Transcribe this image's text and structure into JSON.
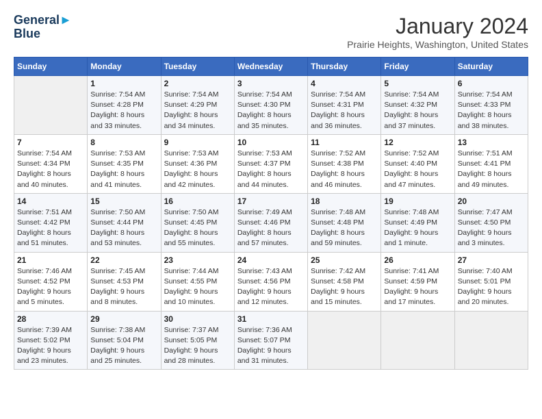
{
  "header": {
    "logo_line1": "General",
    "logo_line2": "Blue",
    "month": "January 2024",
    "location": "Prairie Heights, Washington, United States"
  },
  "weekdays": [
    "Sunday",
    "Monday",
    "Tuesday",
    "Wednesday",
    "Thursday",
    "Friday",
    "Saturday"
  ],
  "weeks": [
    [
      {
        "day": "",
        "info": ""
      },
      {
        "day": "1",
        "info": "Sunrise: 7:54 AM\nSunset: 4:28 PM\nDaylight: 8 hours\nand 33 minutes."
      },
      {
        "day": "2",
        "info": "Sunrise: 7:54 AM\nSunset: 4:29 PM\nDaylight: 8 hours\nand 34 minutes."
      },
      {
        "day": "3",
        "info": "Sunrise: 7:54 AM\nSunset: 4:30 PM\nDaylight: 8 hours\nand 35 minutes."
      },
      {
        "day": "4",
        "info": "Sunrise: 7:54 AM\nSunset: 4:31 PM\nDaylight: 8 hours\nand 36 minutes."
      },
      {
        "day": "5",
        "info": "Sunrise: 7:54 AM\nSunset: 4:32 PM\nDaylight: 8 hours\nand 37 minutes."
      },
      {
        "day": "6",
        "info": "Sunrise: 7:54 AM\nSunset: 4:33 PM\nDaylight: 8 hours\nand 38 minutes."
      }
    ],
    [
      {
        "day": "7",
        "info": "Sunrise: 7:54 AM\nSunset: 4:34 PM\nDaylight: 8 hours\nand 40 minutes."
      },
      {
        "day": "8",
        "info": "Sunrise: 7:53 AM\nSunset: 4:35 PM\nDaylight: 8 hours\nand 41 minutes."
      },
      {
        "day": "9",
        "info": "Sunrise: 7:53 AM\nSunset: 4:36 PM\nDaylight: 8 hours\nand 42 minutes."
      },
      {
        "day": "10",
        "info": "Sunrise: 7:53 AM\nSunset: 4:37 PM\nDaylight: 8 hours\nand 44 minutes."
      },
      {
        "day": "11",
        "info": "Sunrise: 7:52 AM\nSunset: 4:38 PM\nDaylight: 8 hours\nand 46 minutes."
      },
      {
        "day": "12",
        "info": "Sunrise: 7:52 AM\nSunset: 4:40 PM\nDaylight: 8 hours\nand 47 minutes."
      },
      {
        "day": "13",
        "info": "Sunrise: 7:51 AM\nSunset: 4:41 PM\nDaylight: 8 hours\nand 49 minutes."
      }
    ],
    [
      {
        "day": "14",
        "info": "Sunrise: 7:51 AM\nSunset: 4:42 PM\nDaylight: 8 hours\nand 51 minutes."
      },
      {
        "day": "15",
        "info": "Sunrise: 7:50 AM\nSunset: 4:44 PM\nDaylight: 8 hours\nand 53 minutes."
      },
      {
        "day": "16",
        "info": "Sunrise: 7:50 AM\nSunset: 4:45 PM\nDaylight: 8 hours\nand 55 minutes."
      },
      {
        "day": "17",
        "info": "Sunrise: 7:49 AM\nSunset: 4:46 PM\nDaylight: 8 hours\nand 57 minutes."
      },
      {
        "day": "18",
        "info": "Sunrise: 7:48 AM\nSunset: 4:48 PM\nDaylight: 8 hours\nand 59 minutes."
      },
      {
        "day": "19",
        "info": "Sunrise: 7:48 AM\nSunset: 4:49 PM\nDaylight: 9 hours\nand 1 minute."
      },
      {
        "day": "20",
        "info": "Sunrise: 7:47 AM\nSunset: 4:50 PM\nDaylight: 9 hours\nand 3 minutes."
      }
    ],
    [
      {
        "day": "21",
        "info": "Sunrise: 7:46 AM\nSunset: 4:52 PM\nDaylight: 9 hours\nand 5 minutes."
      },
      {
        "day": "22",
        "info": "Sunrise: 7:45 AM\nSunset: 4:53 PM\nDaylight: 9 hours\nand 8 minutes."
      },
      {
        "day": "23",
        "info": "Sunrise: 7:44 AM\nSunset: 4:55 PM\nDaylight: 9 hours\nand 10 minutes."
      },
      {
        "day": "24",
        "info": "Sunrise: 7:43 AM\nSunset: 4:56 PM\nDaylight: 9 hours\nand 12 minutes."
      },
      {
        "day": "25",
        "info": "Sunrise: 7:42 AM\nSunset: 4:58 PM\nDaylight: 9 hours\nand 15 minutes."
      },
      {
        "day": "26",
        "info": "Sunrise: 7:41 AM\nSunset: 4:59 PM\nDaylight: 9 hours\nand 17 minutes."
      },
      {
        "day": "27",
        "info": "Sunrise: 7:40 AM\nSunset: 5:01 PM\nDaylight: 9 hours\nand 20 minutes."
      }
    ],
    [
      {
        "day": "28",
        "info": "Sunrise: 7:39 AM\nSunset: 5:02 PM\nDaylight: 9 hours\nand 23 minutes."
      },
      {
        "day": "29",
        "info": "Sunrise: 7:38 AM\nSunset: 5:04 PM\nDaylight: 9 hours\nand 25 minutes."
      },
      {
        "day": "30",
        "info": "Sunrise: 7:37 AM\nSunset: 5:05 PM\nDaylight: 9 hours\nand 28 minutes."
      },
      {
        "day": "31",
        "info": "Sunrise: 7:36 AM\nSunset: 5:07 PM\nDaylight: 9 hours\nand 31 minutes."
      },
      {
        "day": "",
        "info": ""
      },
      {
        "day": "",
        "info": ""
      },
      {
        "day": "",
        "info": ""
      }
    ]
  ]
}
